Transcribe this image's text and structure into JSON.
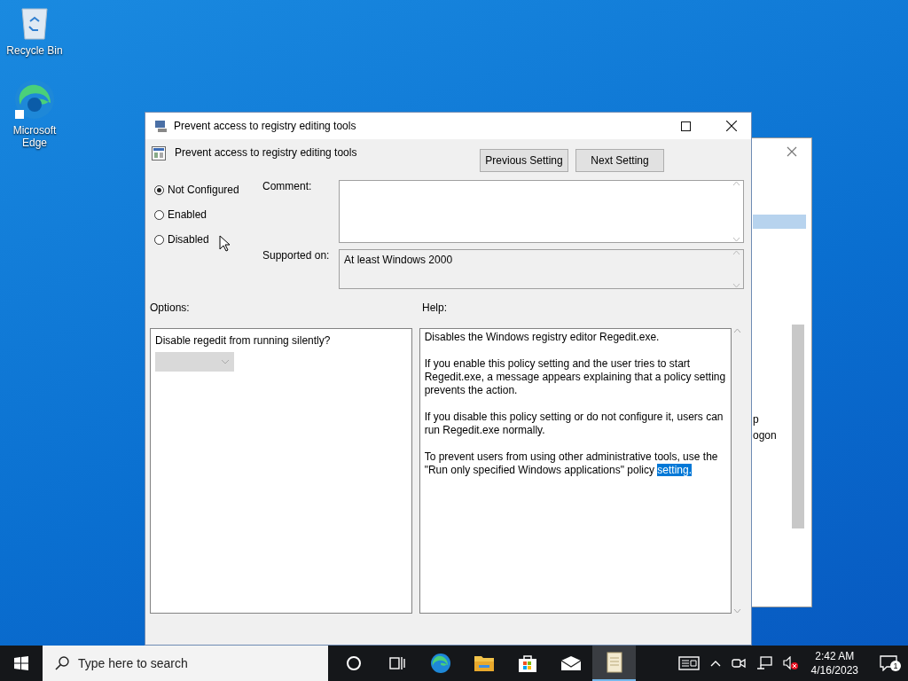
{
  "desktop_icons": [
    {
      "kind": "recycle-bin",
      "label": "Recycle Bin"
    },
    {
      "kind": "edge",
      "label": "Microsoft Edge"
    }
  ],
  "background_window": {
    "texts": [
      "p",
      "ogon"
    ]
  },
  "dialog": {
    "title": "Prevent access to registry editing tools",
    "heading": "Prevent access to registry editing tools",
    "nav_buttons": [
      "Previous Setting",
      "Next Setting"
    ],
    "states": [
      {
        "label": "Not Configured",
        "selected": true
      },
      {
        "label": "Enabled",
        "selected": false
      },
      {
        "label": "Disabled",
        "selected": false
      }
    ],
    "comment_label": "Comment:",
    "supported_label": "Supported on:",
    "supported_value": "At least Windows 2000",
    "options_label": "Options:",
    "help_label": "Help:",
    "options": [
      {
        "kind": "dropdown",
        "label": "Disable regedit from running silently?",
        "disabled": true
      }
    ],
    "help": [
      {
        "text": "Disables the Windows registry editor Regedit.exe."
      },
      {
        "text": "If you enable this policy setting and the user tries to start Regedit.exe, a message appears explaining that a policy setting prevents the action."
      },
      {
        "text": "If you disable this policy setting or do not configure it, users can run Regedit.exe normally."
      },
      {
        "text": "To prevent users from using other administrative tools, use the \"Run only specified Windows applications\" policy ",
        "highlight": "setting."
      }
    ]
  },
  "taskbar": {
    "search_placeholder": "Type here to search",
    "apps": [
      {
        "kind": "cortana",
        "active": false
      },
      {
        "kind": "task-view",
        "active": false
      },
      {
        "kind": "edge",
        "active": false
      },
      {
        "kind": "explorer",
        "active": false
      },
      {
        "kind": "store",
        "active": false
      },
      {
        "kind": "mail",
        "active": false
      },
      {
        "kind": "notepad",
        "active": true
      }
    ],
    "time": "2:42 AM",
    "date": "4/16/2023",
    "notification_count": "1"
  }
}
